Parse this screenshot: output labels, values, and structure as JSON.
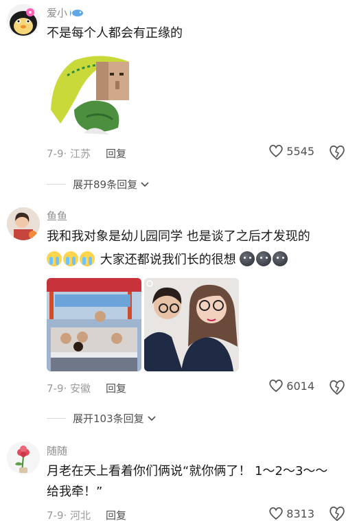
{
  "comments": [
    {
      "username": "爱小",
      "text": "不是每个人都会有正缘的",
      "meta": "7-9· 江苏",
      "reply_label": "回复",
      "likes": "5545",
      "expand_label": "展开89条回复"
    },
    {
      "username": "鱼鱼",
      "text_line1": "我和我对象是幼儿园同学 也是谈了之后才发现的",
      "text_line2": "大家还都说我们长的很想",
      "meta": "7-9· 安徽",
      "reply_label": "回复",
      "likes": "6014",
      "expand_label": "展开103条回复"
    },
    {
      "username": "随随",
      "text_line1": "月老在天上看着你们俩说“就你俩了！ 1～2～3～～",
      "text_line2": "给我牵！”",
      "meta": "7-9· 河北",
      "reply_label": "回复",
      "likes": "8313"
    }
  ],
  "icons": {
    "like": "heart-outline-icon",
    "dislike": "broken-heart-icon",
    "expand": "chevron-down-icon",
    "badge": "fish-badge-icon"
  },
  "colors": {
    "text": "#1a1a1a",
    "muted": "#9a9a9a",
    "username": "#8c8c8c"
  }
}
